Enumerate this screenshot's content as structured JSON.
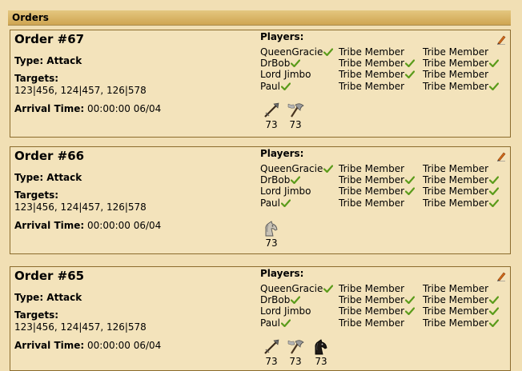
{
  "section": {
    "title": "Orders"
  },
  "orders": [
    {
      "title": "Order #67",
      "type_text": "Type: Attack",
      "targets_label": "Targets:",
      "targets": "123|456, 124|457, 126|578",
      "arrival_label": "Arrival Time:",
      "arrival_value": "00:00:00 06/04",
      "players_label": "Players:",
      "players": [
        {
          "name": "QueenGracie",
          "name_check": true,
          "col2": "Tribe Member",
          "col2_check": false,
          "col3": "Tribe Member",
          "col3_check": false
        },
        {
          "name": "DrBob",
          "name_check": true,
          "col2": "Tribe Member",
          "col2_check": true,
          "col3": "Tribe Member",
          "col3_check": true
        },
        {
          "name": "Lord Jimbo",
          "name_check": false,
          "col2": "Tribe Member",
          "col2_check": true,
          "col3": "Tribe Member",
          "col3_check": false
        },
        {
          "name": "Paul",
          "name_check": true,
          "col2": "Tribe Member",
          "col2_check": false,
          "col3": "Tribe Member",
          "col3_check": true
        }
      ],
      "units": [
        {
          "icon": "spear-icon",
          "count": "73"
        },
        {
          "icon": "axe-icon",
          "count": "73"
        }
      ]
    },
    {
      "title": "Order #66",
      "type_text": "Type: Attack",
      "targets_label": "Targets:",
      "targets": "123|456, 124|457, 126|578",
      "arrival_label": "Arrival Time:",
      "arrival_value": "00:00:00 06/04",
      "players_label": "Players:",
      "players": [
        {
          "name": "QueenGracie",
          "name_check": true,
          "col2": "Tribe Member",
          "col2_check": false,
          "col3": "Tribe Member",
          "col3_check": false
        },
        {
          "name": "DrBob",
          "name_check": true,
          "col2": "Tribe Member",
          "col2_check": true,
          "col3": "Tribe Member",
          "col3_check": true
        },
        {
          "name": "Lord Jimbo",
          "name_check": false,
          "col2": "Tribe Member",
          "col2_check": true,
          "col3": "Tribe Member",
          "col3_check": true
        },
        {
          "name": "Paul",
          "name_check": true,
          "col2": "Tribe Member",
          "col2_check": false,
          "col3": "Tribe Member",
          "col3_check": true
        }
      ],
      "units": [
        {
          "icon": "light-cavalry-icon",
          "count": "73"
        }
      ]
    },
    {
      "title": "Order #65",
      "type_text": "Type: Attack",
      "targets_label": "Targets:",
      "targets": "123|456, 124|457, 126|578",
      "arrival_label": "Arrival Time:",
      "arrival_value": "00:00:00 06/04",
      "players_label": "Players:",
      "players": [
        {
          "name": "QueenGracie",
          "name_check": true,
          "col2": "Tribe Member",
          "col2_check": false,
          "col3": "Tribe Member",
          "col3_check": false
        },
        {
          "name": "DrBob",
          "name_check": true,
          "col2": "Tribe Member",
          "col2_check": true,
          "col3": "Tribe Member",
          "col3_check": true
        },
        {
          "name": "Lord Jimbo",
          "name_check": false,
          "col2": "Tribe Member",
          "col2_check": true,
          "col3": "Tribe Member",
          "col3_check": true
        },
        {
          "name": "Paul",
          "name_check": true,
          "col2": "Tribe Member",
          "col2_check": false,
          "col3": "Tribe Member",
          "col3_check": true
        }
      ],
      "units": [
        {
          "icon": "spear-icon",
          "count": "73"
        },
        {
          "icon": "axe-icon",
          "count": "73"
        },
        {
          "icon": "heavy-cavalry-icon",
          "count": "73"
        }
      ]
    }
  ],
  "colors": {
    "check": "#5a9b1a",
    "box_border": "#8b6b2c",
    "box_bg": "#f3e3bb",
    "page_bg": "#f1dfb4"
  }
}
